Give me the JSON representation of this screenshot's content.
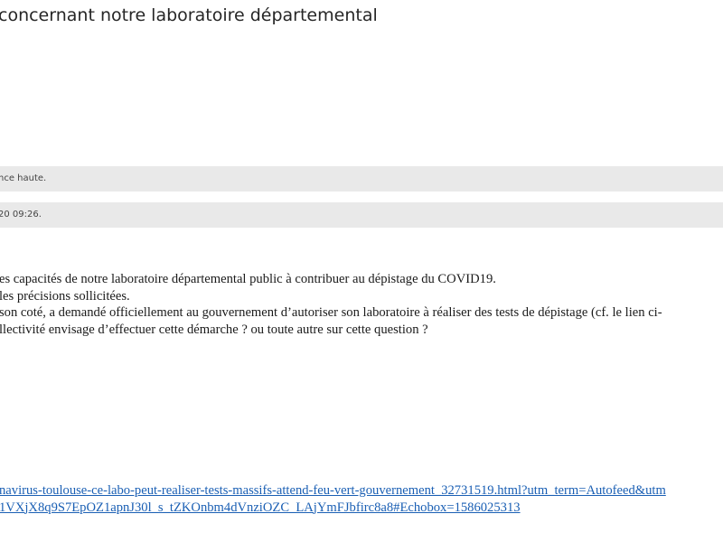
{
  "email": {
    "subject": "concernant notre laboratoire départemental",
    "importance_notice": "nce haute.",
    "sent_notice": "20 09:26.",
    "body_lines": [
      "es capacités de notre laboratoire départemental public à contribuer au dépistage du COVID19.",
      "les précisions sollicitées.",
      "son coté, a demandé officiellement au gouvernement d’autoriser son laboratoire à réaliser des tests de dépistage (cf. le lien ci-",
      "llectivité envisage d’effectuer cette démarche ? ou toute autre sur cette question ?"
    ],
    "link_lines": [
      "navirus-toulouse-ce-labo-peut-realiser-tests-massifs-attend-feu-vert-gouvernement_32731519.html?utm_term=Autofeed&utm",
      "1VXjX8q9S7EpOZ1apnJ30l_s_tZKOnbm4dVnziOZC_LAjYmFJbfirc8a8#Echobox=1586025313"
    ]
  }
}
